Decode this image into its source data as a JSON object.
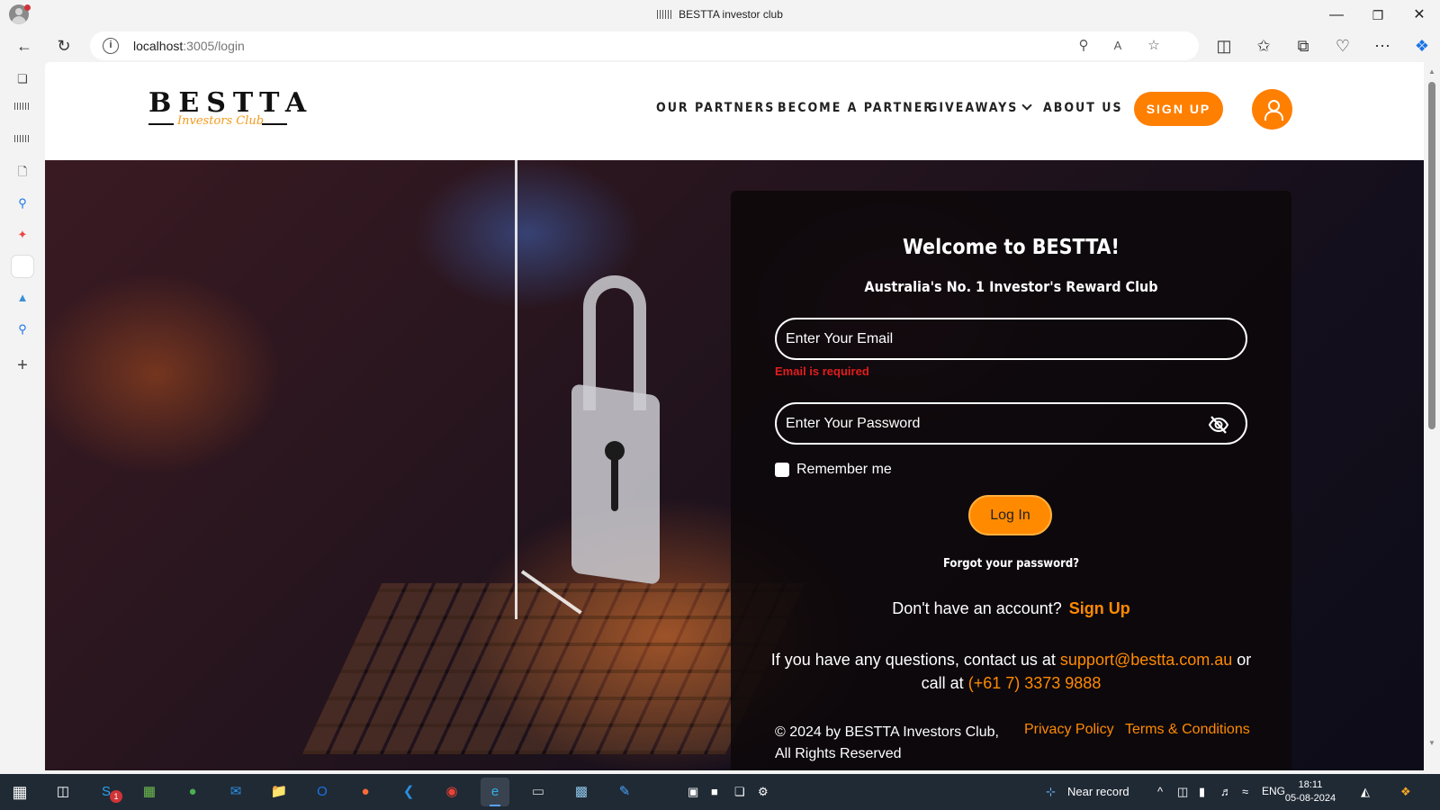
{
  "browser": {
    "tab_title": "BESTTA investor club",
    "url_host": "localhost",
    "url_path": ":3005/login",
    "minimize": "—",
    "maximize": "❐",
    "close": "✕"
  },
  "site": {
    "logo_word": "BESTTA",
    "logo_tag": "Investors Club",
    "nav": [
      "OUR PARTNERS",
      "BECOME A PARTNER",
      "GIVEAWAYS",
      "ABOUT US"
    ],
    "signup_label": "SIGN UP"
  },
  "login": {
    "title": "Welcome to BESTTA!",
    "subtitle": "Australia's No. 1 Investor's Reward Club",
    "email_placeholder": "Enter Your Email",
    "email_error": "Email is required",
    "password_placeholder": "Enter Your Password",
    "remember_label": "Remember me",
    "remember_checked": false,
    "login_label": "Log In",
    "forgot_label": "Forgot your password?",
    "no_account_text": "Don't have an account?",
    "signup_link": "Sign Up",
    "contact_prefix": "If you have any questions, contact us at",
    "contact_email": "support@bestta.com.au",
    "contact_mid": "or call at",
    "contact_phone": "(+61 7) 3373 9888",
    "copyright": "© 2024 by BESTTA Investors Club, All Rights Reserved",
    "privacy_label": "Privacy Policy",
    "terms_label": "Terms & Conditions"
  },
  "taskbar": {
    "weather_text": "Near record",
    "language": "ENG",
    "time": "18:11",
    "date": "05-08-2024",
    "skype_badge": "1"
  },
  "colors": {
    "accent_orange": "#ff7f00",
    "error_red": "#e11d1d",
    "card_bg": "#0c080a"
  }
}
